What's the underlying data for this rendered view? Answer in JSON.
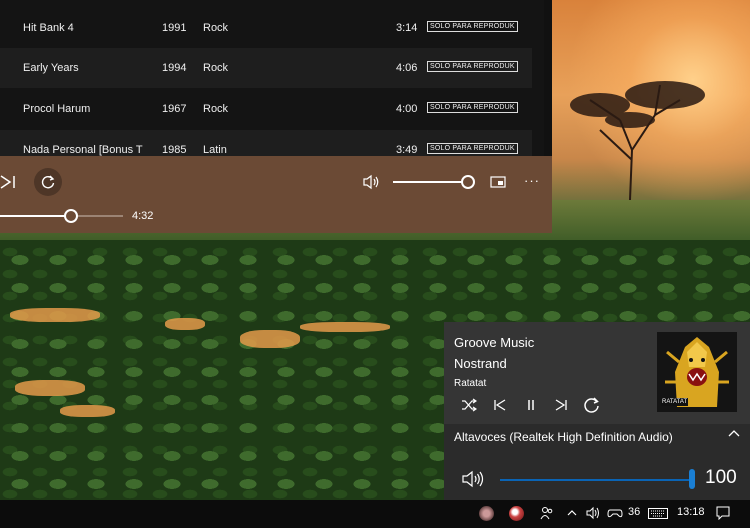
{
  "tracks": [
    {
      "title": "Hit Bank 4",
      "year": "1991",
      "genre": "Rock",
      "duration": "3:14",
      "badge": "SOLO PARA REPRODUK"
    },
    {
      "title": "Early Years",
      "year": "1994",
      "genre": "Rock",
      "duration": "4:06",
      "badge": "SOLO PARA REPRODUK"
    },
    {
      "title": "Procol Harum",
      "year": "1967",
      "genre": "Rock",
      "duration": "4:00",
      "badge": "SOLO PARA REPRODUK"
    },
    {
      "title": "Nada Personal [Bonus Tra",
      "year": "1985",
      "genre": "Latin",
      "duration": "3:49",
      "badge": "SOLO PARA REPRODUK"
    }
  ],
  "player": {
    "total_time": "4:32",
    "volume_level": 1.0,
    "seek_progress": 0.57,
    "icons": {
      "next": "skip-next-icon",
      "repeat": "repeat-icon",
      "volume": "volume-icon",
      "miniplayer": "miniplayer-icon",
      "more": "more-icon"
    },
    "more_glyph": "···"
  },
  "flyout": {
    "app_name": "Groove Music",
    "track": "Nostrand",
    "artist": "Ratatat",
    "album_art_text": "RATATAT",
    "device": "Altavoces (Realtek High Definition Audio)",
    "volume_value": "100",
    "volume_level": 1.0
  },
  "taskbar": {
    "badge_count": "36",
    "clock": "13:18"
  },
  "colors": {
    "player_bg": "#6b4a35",
    "accent": "#1a7fd4",
    "list_bg": "#141414"
  }
}
